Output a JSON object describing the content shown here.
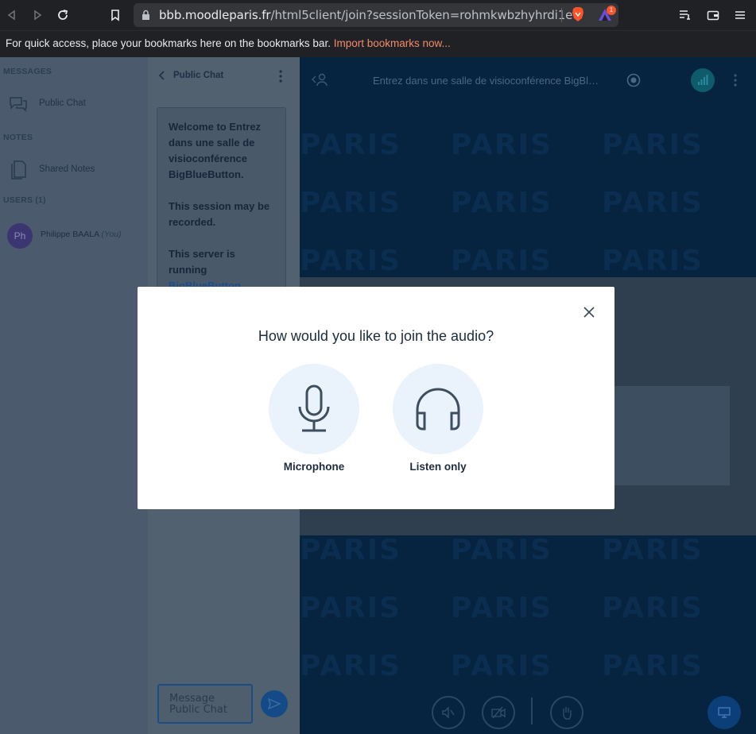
{
  "browser": {
    "url_host": "bbb.moodleparis.fr",
    "url_path": "/html5client/join?sessionToken=rohmkwbzhyhrdi1e",
    "bookmarks_message": "For quick access, place your bookmarks here on the bookmarks bar.",
    "bookmarks_link": "Import bookmarks now...",
    "notification_badge": "1"
  },
  "sidebar": {
    "messages_heading": "MESSAGES",
    "public_chat_label": "Public Chat",
    "notes_heading": "NOTES",
    "shared_notes_label": "Shared Notes",
    "users_heading": "USERS (1)",
    "user": {
      "initials": "Ph",
      "name": "Philippe BAALA",
      "you_tag": "(You)"
    }
  },
  "chat": {
    "title": "Public Chat",
    "welcome_line1": "Welcome to Entrez dans une salle de visioconférence BigBlueButton.",
    "welcome_line2": "This session may be recorded.",
    "welcome_line3_prefix": "This server is running",
    "welcome_line3_link": "BigBlueButton",
    "welcome_line3_suffix": ".",
    "input_placeholder": "Message Public Chat"
  },
  "main": {
    "title": "Entrez dans une salle de visioconférence BigBl…",
    "watermark": "PARIS"
  },
  "modal": {
    "title": "How would you like to join the audio?",
    "microphone_label": "Microphone",
    "listen_only_label": "Listen only"
  },
  "colors": {
    "accent": "#1b4f8a",
    "modal_option_bg": "#eaf3fc",
    "main_bg": "#06233f"
  }
}
